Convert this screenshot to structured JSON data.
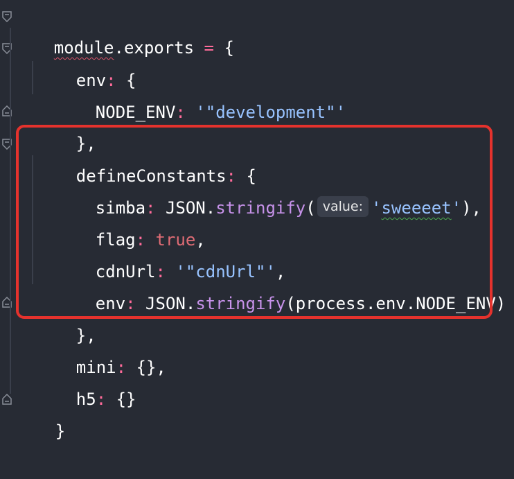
{
  "code": {
    "l1": {
      "ident": "module",
      "dot": ".",
      "prop": "exports",
      "eq": " = ",
      "brace": "{"
    },
    "l2": {
      "key": "env",
      "colon": ":",
      "brace": " {"
    },
    "l3": {
      "key": "NODE_ENV",
      "colon": ":",
      "val": " '\"development\"'"
    },
    "l4": {
      "close": "},"
    },
    "l5": {
      "key": "defineConstants",
      "colon": ":",
      "brace": " {"
    },
    "l6": {
      "key": "simba",
      "colon": ":",
      "obj": " JSON",
      "dot": ".",
      "fn": "stringify",
      "paren": "(",
      "hint": "value:",
      "q1": "'",
      "val": "sweeeet",
      "q2": "'",
      "tail": "),"
    },
    "l7": {
      "key": "flag",
      "colon": ":",
      "val": " true",
      "comma": ","
    },
    "l8": {
      "key": "cdnUrl",
      "colon": ":",
      "val": " '\"cdnUrl\"'",
      "comma": ","
    },
    "l9": {
      "key": "env",
      "colon": ":",
      "obj": " JSON",
      "dot": ".",
      "fn": "stringify",
      "arg": "(process.env.NODE_ENV)"
    },
    "l10": {
      "close": "},"
    },
    "l11": {
      "key": "mini",
      "colon": ":",
      "val": " {},"
    },
    "l12": {
      "key": "h5",
      "colon": ":",
      "val": " {}"
    },
    "l13": {
      "close": "}"
    }
  },
  "colors": {
    "background": "#272b34",
    "highlight_border": "#e5322d",
    "string": "#98c3ff",
    "function": "#c792ea",
    "keyword": "#e06c75"
  },
  "icons": [
    "fold-open-icon",
    "fold-close-icon"
  ]
}
